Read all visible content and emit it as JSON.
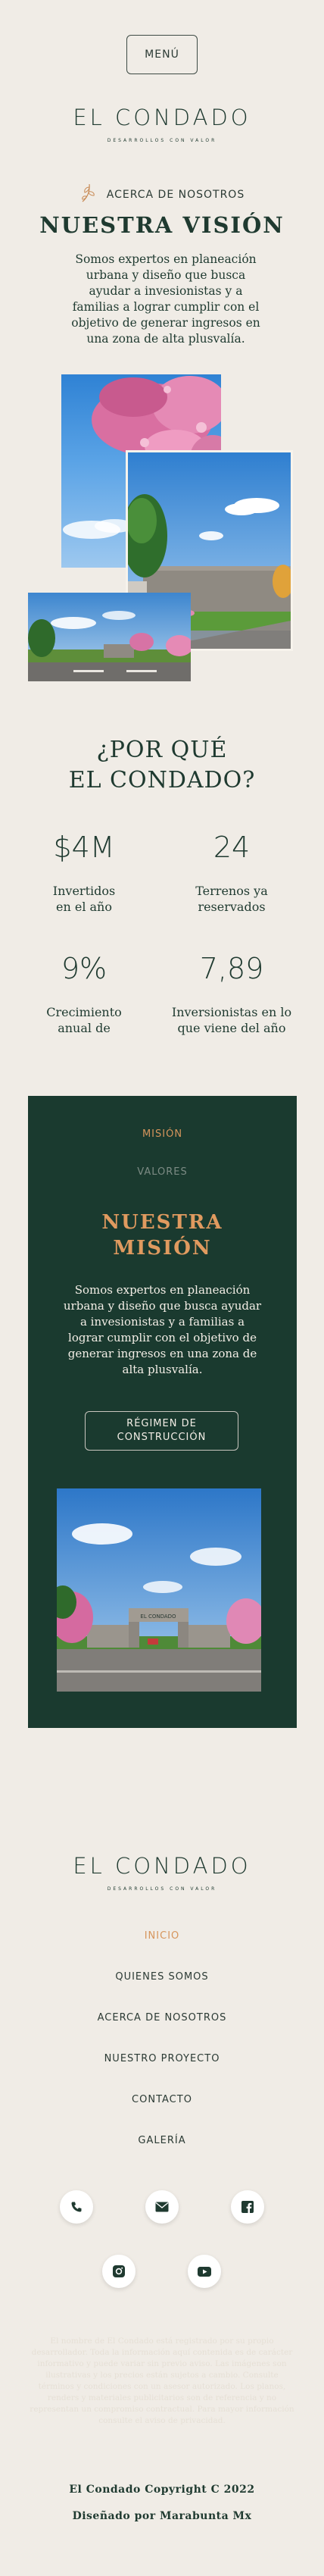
{
  "header": {
    "menu_label": "MENÚ",
    "brand": "EL CONDADO",
    "tagline": "DESARROLLOS CON VALOR"
  },
  "about": {
    "label": "ACERCA DE NOSOTROS",
    "title": "NUESTRA VISIÓN",
    "paragraph": "Somos expertos en planeación urbana y diseño que busca ayudar a invesionistas y a familias a lograr cumplir con el objetivo de generar ingresos en una zona de alta plusvalía."
  },
  "why": {
    "title_line1": "¿POR QUÉ",
    "title_line2": "EL CONDADO?",
    "stats": [
      {
        "value": "$4M",
        "label_line1": "Invertidos",
        "label_line2": "en el año"
      },
      {
        "value": "24",
        "label_line1": "Terrenos ya",
        "label_line2": "reservados"
      },
      {
        "value": "9%",
        "label_line1": "Crecimiento",
        "label_line2": "anual de"
      },
      {
        "value": "7,89",
        "label_line1": "Inversionistas en lo",
        "label_line2": "que viene del año"
      }
    ]
  },
  "mission": {
    "tab_active": "MISIÓN",
    "tab_inactive": "VALORES",
    "title_line1": "NUESTRA",
    "title_line2": "MISIÓN",
    "paragraph": "Somos expertos en planeación urbana y diseño que busca ayudar a invesionistas y a familias a lograr cumplir con el objetivo de generar ingresos en una zona de alta plusvalía.",
    "button_line1": "RÉGIMEN DE",
    "button_line2": "CONSTRUCCIÓN",
    "gate_sign": "EL CONDADO"
  },
  "footer": {
    "brand": "EL CONDADO",
    "tagline": "DESARROLLOS CON VALOR",
    "nav": [
      "INICIO",
      "QUIENES SOMOS",
      "ACERCA DE NOSOTROS",
      "NUESTRO PROYECTO",
      "CONTACTO",
      "GALERÍA"
    ],
    "legal": "El nombre de El Condado está registrado por su propio desarrollador. Toda la información aquí contenida es de carácter informativo y puede variar sin previo aviso. Las imágenes son ilustrativas y los precios están sujetos a cambio. Consulte términos y condiciones con un asesor autorizado. Los planos, renders y materiales publicitarios son de referencia y no representan un compromiso contractual. Para mayor información consulte el aviso de privacidad.",
    "copyright": "El Condado Copyright C 2022",
    "credit": "Diseñado por Marabunta Mx"
  },
  "colors": {
    "background": "#f0ece6",
    "dark_green": "#1a3a2f",
    "accent": "#d6955c"
  },
  "icons": [
    "leaf-icon",
    "phone-icon",
    "mail-icon",
    "facebook-icon",
    "instagram-icon",
    "youtube-icon"
  ]
}
